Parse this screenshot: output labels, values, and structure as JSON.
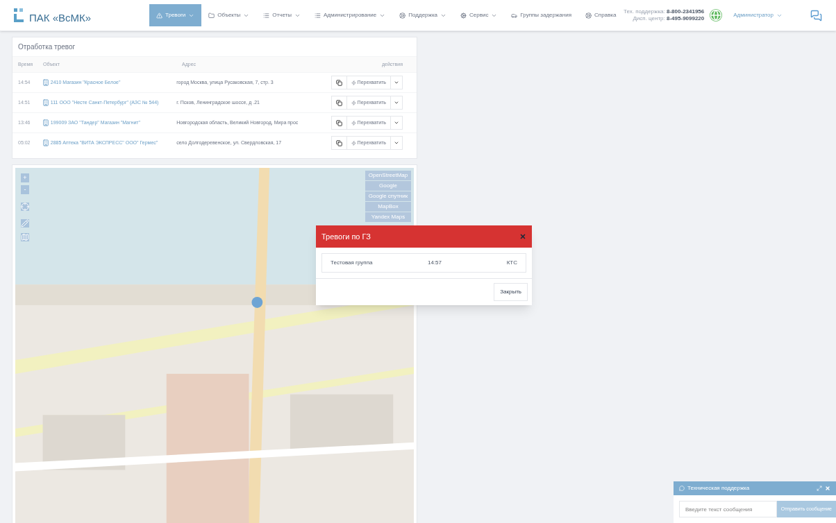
{
  "brand": "ПАК «ВсМК»",
  "nav": [
    {
      "label": "Тревоги",
      "dropdown": true,
      "selected": true
    },
    {
      "label": "Объекты",
      "dropdown": true,
      "selected": false
    },
    {
      "label": "Отчеты",
      "dropdown": true,
      "selected": false
    },
    {
      "label": "Администрирование",
      "dropdown": true,
      "selected": false
    },
    {
      "label": "Поддержка",
      "dropdown": true,
      "selected": false
    },
    {
      "label": "Сервис",
      "dropdown": true,
      "selected": false
    },
    {
      "label": "Группы задержания",
      "dropdown": false,
      "selected": false
    },
    {
      "label": "Справка",
      "dropdown": false,
      "selected": false
    }
  ],
  "contacts": [
    {
      "label": "Тех. поддержка:",
      "phone": "8-800-2341956"
    },
    {
      "label": "Дисп. центр:",
      "phone": "8-495-9099220"
    }
  ],
  "user": "Администратор",
  "alarms": {
    "title": "Отработка тревог",
    "columns": [
      "Время",
      "Объект",
      "Адрес",
      "действия"
    ],
    "rows": [
      {
        "time": "14:54",
        "object": "2410 Магазин \"Красное Белое\"",
        "address": "город Москва, улица Русаковская, 7, стр. 3",
        "action": "Перехватить"
      },
      {
        "time": "14:51",
        "object": "111 ООО \"Несте Санкт-Петербург\" (АЗС № 544)",
        "address": "г. Псков, Ленинградское шоссе, д .21",
        "action": "Перехватить"
      },
      {
        "time": "13:46",
        "object": "199009 ЗАО \"Тандер\" Магазин \"Магнит\"",
        "address": "Новгородская область, Великий Новгород, Мира прос",
        "action": "Перехватить"
      },
      {
        "time": "05:02",
        "object": "2885 Аптека \"ВИТА ЭКСПРЕСС\" ООО\" Гермес\"",
        "address": "село Долгодеревенское, ул. Свердловская, 17",
        "action": "Перехватить"
      }
    ]
  },
  "map": {
    "layers": [
      "OpenStreetMap",
      "Google",
      "Google спутник",
      "MapBox",
      "Yandex Maps"
    ],
    "zoom_in": "+",
    "zoom_out": "-"
  },
  "modal": {
    "title": "Тревоги по ГЗ",
    "group": "Тестовая группа",
    "time": "14:57",
    "type": "КТС",
    "close": "Закрыть"
  },
  "chat": {
    "title": "Техническая поддержка",
    "placeholder": "Введите текст сообщения",
    "send": "Отправить сообщение"
  }
}
